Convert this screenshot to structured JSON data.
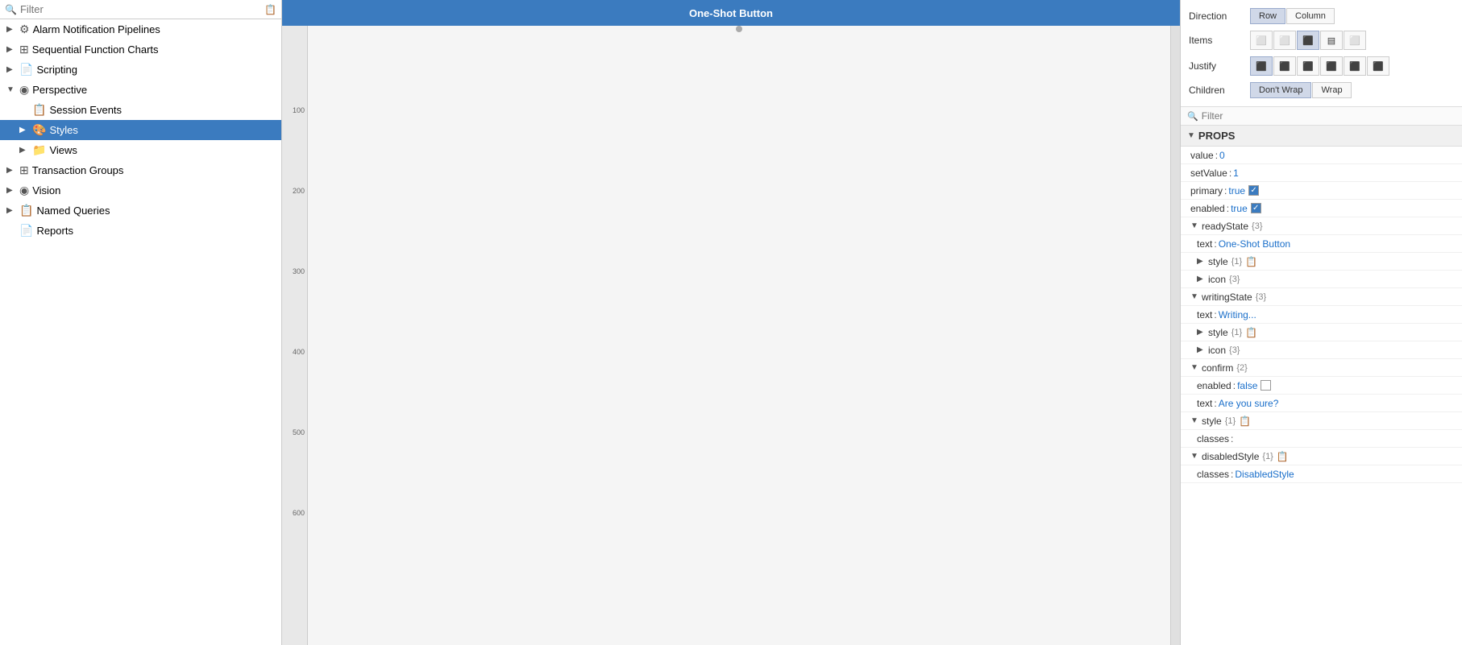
{
  "sidebar": {
    "search_placeholder": "Filter",
    "items": [
      {
        "id": "alarm-pipelines",
        "label": "Alarm Notification Pipelines",
        "depth": 0,
        "expanded": false,
        "icon": "⚙",
        "hasArrow": true
      },
      {
        "id": "sequential-function-charts",
        "label": "Sequential Function Charts",
        "depth": 0,
        "expanded": false,
        "icon": "⊞",
        "hasArrow": true
      },
      {
        "id": "scripting",
        "label": "Scripting",
        "depth": 0,
        "expanded": false,
        "icon": "📄",
        "hasArrow": true
      },
      {
        "id": "perspective",
        "label": "Perspective",
        "depth": 0,
        "expanded": true,
        "icon": "◉",
        "hasArrow": true
      },
      {
        "id": "session-events",
        "label": "Session Events",
        "depth": 1,
        "expanded": false,
        "icon": "📋",
        "hasArrow": false
      },
      {
        "id": "styles",
        "label": "Styles",
        "depth": 1,
        "expanded": false,
        "icon": "🎨",
        "hasArrow": true,
        "selected": true
      },
      {
        "id": "views",
        "label": "Views",
        "depth": 1,
        "expanded": false,
        "icon": "📁",
        "hasArrow": true
      },
      {
        "id": "transaction-groups",
        "label": "Transaction Groups",
        "depth": 0,
        "expanded": false,
        "icon": "⊞",
        "hasArrow": true
      },
      {
        "id": "vision",
        "label": "Vision",
        "depth": 0,
        "expanded": false,
        "icon": "◉",
        "hasArrow": true
      },
      {
        "id": "named-queries",
        "label": "Named Queries",
        "depth": 0,
        "expanded": false,
        "icon": "📋",
        "hasArrow": true
      },
      {
        "id": "reports",
        "label": "Reports",
        "depth": 0,
        "expanded": false,
        "icon": "📄",
        "hasArrow": false
      }
    ]
  },
  "canvas": {
    "title": "One-Shot Button",
    "ruler_marks": [
      "100",
      "200",
      "300",
      "400",
      "500",
      "600"
    ]
  },
  "right_panel": {
    "direction": {
      "label": "Direction",
      "options": [
        "Row",
        "Column"
      ],
      "active": "Column"
    },
    "items": {
      "label": "Items",
      "buttons": [
        "⊟",
        "⊠",
        "⊡",
        "⊢",
        "⊣"
      ]
    },
    "justify": {
      "label": "Justify",
      "buttons": [
        "≡",
        "≡",
        "≡",
        "≡",
        "≡",
        "≡"
      ]
    },
    "children": {
      "label": "Children",
      "options": [
        "Don't Wrap",
        "Wrap"
      ],
      "active": "Don't Wrap"
    },
    "filter_placeholder": "Filter",
    "props_section_label": "PROPS",
    "props": [
      {
        "key": "value",
        "colon": ":",
        "val": "0",
        "val_type": "blue",
        "depth": 0,
        "expandable": false
      },
      {
        "key": "setValue",
        "colon": ":",
        "val": "1",
        "val_type": "blue",
        "depth": 0,
        "expandable": false
      },
      {
        "key": "primary",
        "colon": ":",
        "val": "true",
        "val_type": "blue",
        "depth": 0,
        "expandable": false,
        "checkbox": "checked"
      },
      {
        "key": "enabled",
        "colon": ":",
        "val": "true",
        "val_type": "blue",
        "depth": 0,
        "expandable": false,
        "checkbox": "checked"
      },
      {
        "key": "readyState",
        "count": "{3}",
        "depth": 0,
        "expandable": true,
        "expanded": true
      },
      {
        "key": "text",
        "colon": ":",
        "val": "One-Shot Button",
        "val_type": "blue",
        "depth": 1,
        "expandable": false
      },
      {
        "key": "style",
        "count": "{1}",
        "depth": 1,
        "expandable": true,
        "expanded": false,
        "hasNote": true
      },
      {
        "key": "icon",
        "count": "{3}",
        "depth": 1,
        "expandable": true,
        "expanded": false
      },
      {
        "key": "writingState",
        "count": "{3}",
        "depth": 0,
        "expandable": true,
        "expanded": true
      },
      {
        "key": "text",
        "colon": ":",
        "val": "Writing...",
        "val_type": "blue",
        "depth": 1,
        "expandable": false
      },
      {
        "key": "style",
        "count": "{1}",
        "depth": 1,
        "expandable": true,
        "expanded": false,
        "hasNote": true
      },
      {
        "key": "icon",
        "count": "{3}",
        "depth": 1,
        "expandable": true,
        "expanded": false
      },
      {
        "key": "confirm",
        "count": "{2}",
        "depth": 0,
        "expandable": true,
        "expanded": true
      },
      {
        "key": "enabled",
        "colon": ":",
        "val": "false",
        "val_type": "blue",
        "depth": 1,
        "expandable": false,
        "checkbox": "unchecked"
      },
      {
        "key": "text",
        "colon": ":",
        "val": "Are you sure?",
        "val_type": "blue",
        "depth": 1,
        "expandable": false
      },
      {
        "key": "style",
        "count": "{1}",
        "depth": 0,
        "expandable": true,
        "expanded": true,
        "hasNote": true
      },
      {
        "key": "classes",
        "colon": ":",
        "val": "",
        "val_type": "blue",
        "depth": 1,
        "expandable": false
      },
      {
        "key": "disabledStyle",
        "count": "{1}",
        "depth": 0,
        "expandable": true,
        "expanded": true,
        "hasNote": true
      },
      {
        "key": "classes",
        "colon": ":",
        "val": "DisabledStyle",
        "val_type": "blue",
        "depth": 1,
        "expandable": false
      }
    ]
  }
}
